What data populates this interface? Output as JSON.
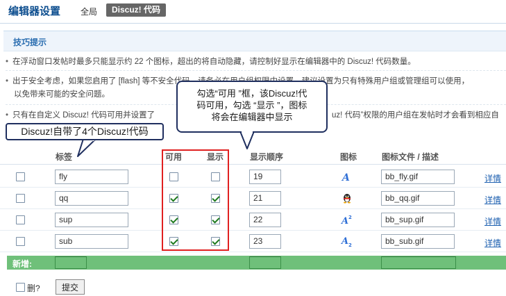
{
  "header": {
    "title": "编辑器设置",
    "nav_global": "全局",
    "nav_active": "Discuz! 代码"
  },
  "tips": {
    "title": "技巧提示",
    "items": [
      "在浮动窗口发帖时最多只能显示约 22 个图标，超出的将自动隐藏，请控制好显示在编辑器中的 Discuz! 代码数量。",
      "出于安全考虑，如果您启用了 [flash] 等不安全代码，请务必在用户组权限中设置，建议设置为只有特殊用户组或管理组可以使用，",
      "以免带来可能的安全问题。",
      "只有在自定义 Discuz! 代码可用并设置了",
      "uz! 代码”权限的用户组在发帖时才会看到相应自"
    ]
  },
  "table": {
    "headers": {
      "tag": "标签",
      "enabled": "可用",
      "display": "显示",
      "order": "显示顺序",
      "icon": "图标",
      "file": "图标文件 / 描述"
    },
    "rows": [
      {
        "tag": "fly",
        "enabled": false,
        "display": false,
        "order": "19",
        "icon": "font-fly-icon",
        "file": "bb_fly.gif",
        "detail": "详情"
      },
      {
        "tag": "qq",
        "enabled": true,
        "display": true,
        "order": "21",
        "icon": "qq-penguin-icon",
        "file": "bb_qq.gif",
        "detail": "详情"
      },
      {
        "tag": "sup",
        "enabled": true,
        "display": true,
        "order": "22",
        "icon": "superscript-icon",
        "file": "bb_sup.gif",
        "detail": "详情"
      },
      {
        "tag": "sub",
        "enabled": true,
        "display": true,
        "order": "23",
        "icon": "subscript-icon",
        "file": "bb_sub.gif",
        "detail": "详情"
      }
    ],
    "add_label": "新增:"
  },
  "footer": {
    "delete_label": "删?",
    "submit_label": "提交"
  },
  "annotations": {
    "callout_enable_lines": [
      "勾选“可用 ”框，该Discuz!代",
      "码可用，勾选 “显示 ”，图标",
      "将会在编辑器中显示"
    ],
    "callout_builtin": "Discuz!自带了4个Discuz!代码"
  },
  "colors": {
    "title_blue": "#0d4e8f",
    "add_bar_green": "#6fc07a",
    "highlight_red": "#e02020",
    "link_blue": "#1c5fb0"
  }
}
